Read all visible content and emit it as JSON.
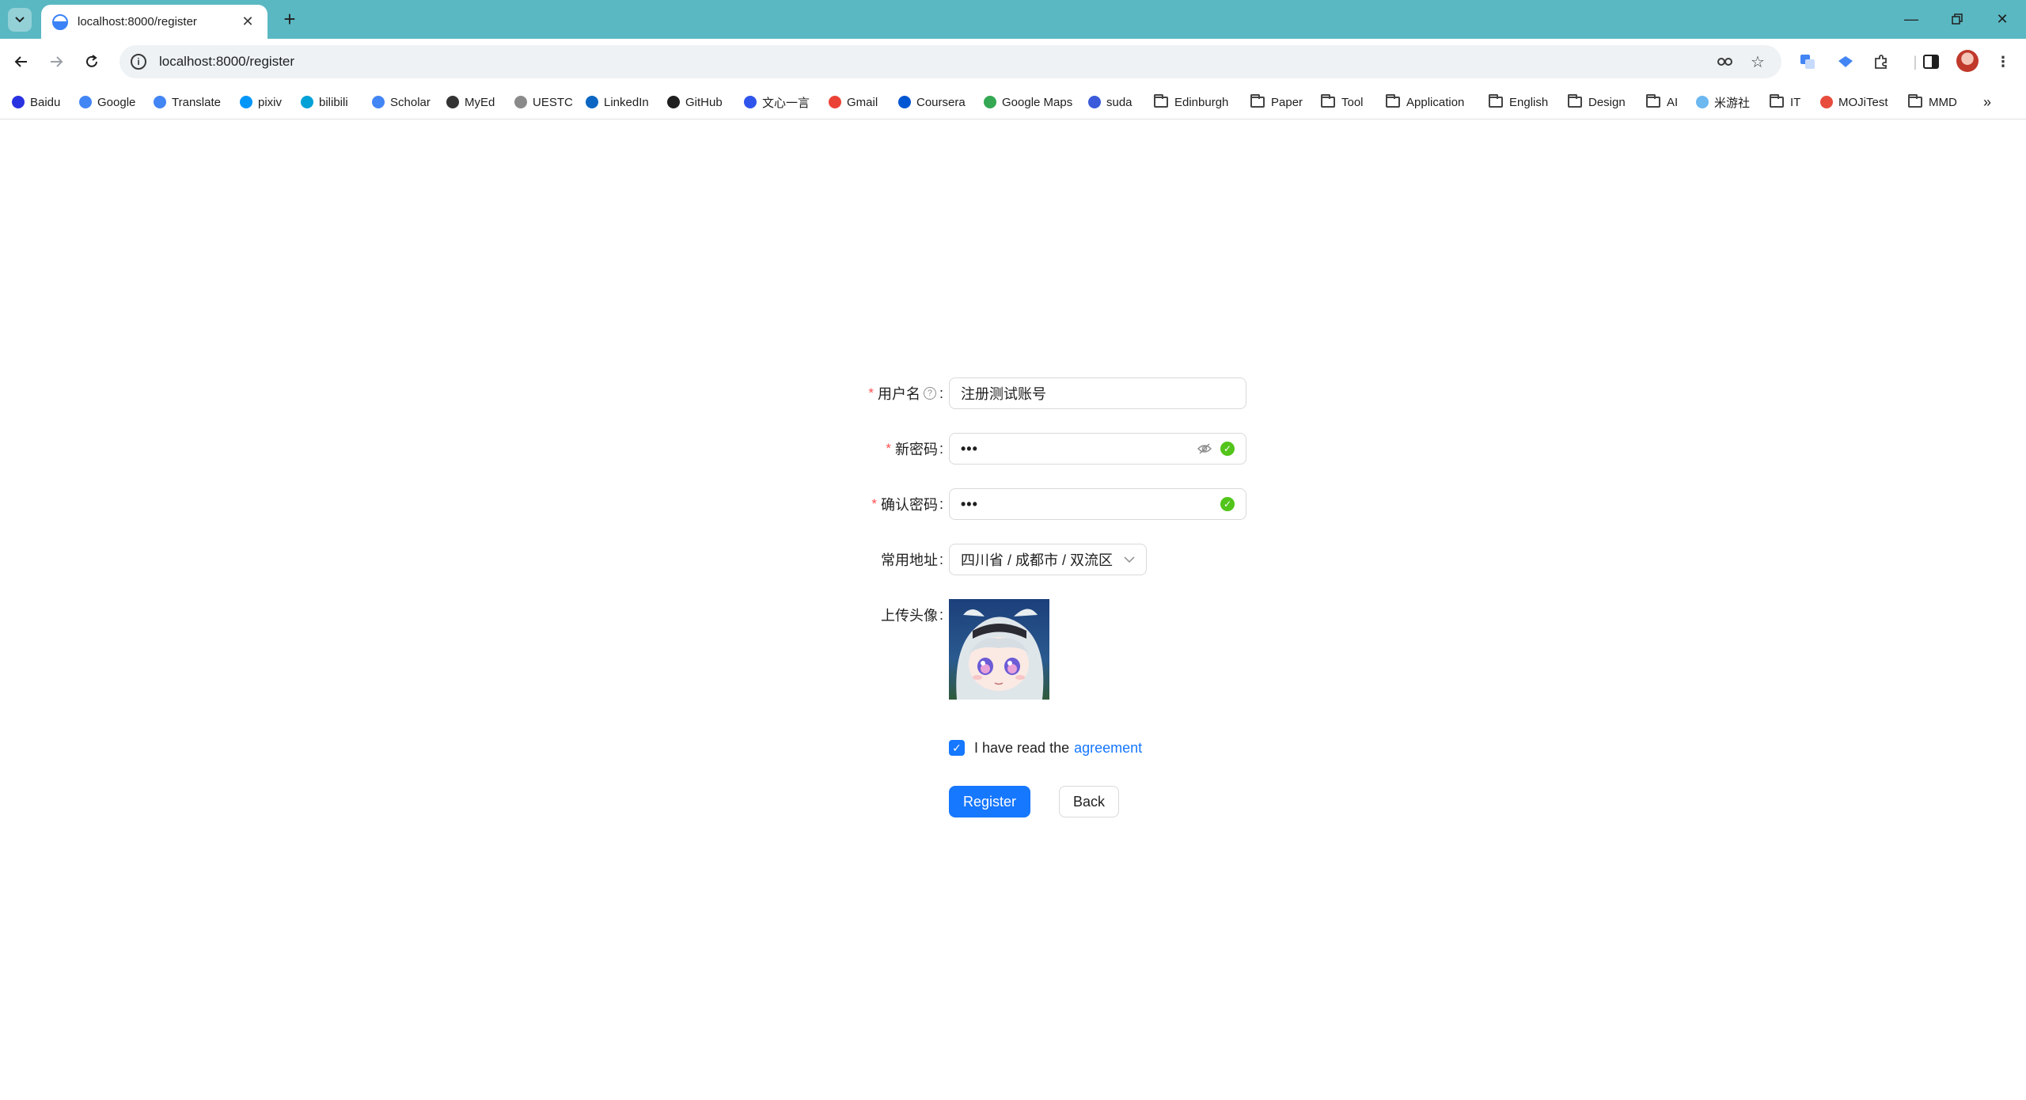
{
  "browser": {
    "tab_title": "localhost:8000/register",
    "url": "localhost:8000/register",
    "bookmarks": [
      {
        "label": "Baidu",
        "icon": "baidu-icon",
        "color": "#2932e1"
      },
      {
        "label": "Google",
        "icon": "google-icon",
        "color": "#4285f4"
      },
      {
        "label": "Translate",
        "icon": "translate-icon",
        "color": "#4285f4"
      },
      {
        "label": "pixiv",
        "icon": "pixiv-icon",
        "color": "#0096fa"
      },
      {
        "label": "bilibili",
        "icon": "bilibili-icon",
        "color": "#00a1d6"
      },
      {
        "label": "Scholar",
        "icon": "scholar-icon",
        "color": "#4285f4"
      },
      {
        "label": "MyEd",
        "icon": "myed-icon",
        "color": "#333333"
      },
      {
        "label": "UESTC",
        "icon": "uestc-icon",
        "color": "#8a8a8a"
      },
      {
        "label": "LinkedIn",
        "icon": "linkedin-icon",
        "color": "#0a66c2"
      },
      {
        "label": "GitHub",
        "icon": "github-icon",
        "color": "#1f1f1f"
      },
      {
        "label": "文心一言",
        "icon": "wenxin-icon",
        "color": "#2f54eb"
      },
      {
        "label": "Gmail",
        "icon": "gmail-icon",
        "color": "#ea4335"
      },
      {
        "label": "Coursera",
        "icon": "coursera-icon",
        "color": "#0056d2"
      },
      {
        "label": "Google Maps",
        "icon": "maps-icon",
        "color": "#34a853"
      },
      {
        "label": "suda",
        "icon": "suda-icon",
        "color": "#3b5bdb"
      },
      {
        "label": "Edinburgh",
        "icon": "folder-icon"
      },
      {
        "label": "Paper",
        "icon": "folder-icon"
      },
      {
        "label": "Tool",
        "icon": "folder-icon"
      },
      {
        "label": "Application",
        "icon": "folder-icon"
      },
      {
        "label": "English",
        "icon": "folder-icon"
      },
      {
        "label": "Design",
        "icon": "folder-icon"
      },
      {
        "label": "AI",
        "icon": "folder-icon"
      },
      {
        "label": "米游社",
        "icon": "miyoushe-icon",
        "color": "#6cb8f0"
      },
      {
        "label": "IT",
        "icon": "folder-icon"
      },
      {
        "label": "MOJiTest",
        "icon": "mojitest-icon",
        "color": "#e74c3c"
      },
      {
        "label": "MMD",
        "icon": "folder-icon"
      }
    ]
  },
  "form": {
    "username": {
      "label": "用户名",
      "value": "注册测试账号"
    },
    "password": {
      "label": "新密码",
      "value": "•••"
    },
    "confirm": {
      "label": "确认密码",
      "value": "•••"
    },
    "address": {
      "label": "常用地址",
      "value": "四川省 / 成都市 / 双流区"
    },
    "avatar": {
      "label": "上传头像"
    },
    "agreement": {
      "text": "I have read the",
      "link": "agreement",
      "checked": true
    },
    "register_button": "Register",
    "back_button": "Back"
  },
  "colors": {
    "chrome_bg": "#5ab8c2",
    "primary": "#1677ff",
    "required": "#ff4d4f",
    "success": "#52c41a"
  }
}
